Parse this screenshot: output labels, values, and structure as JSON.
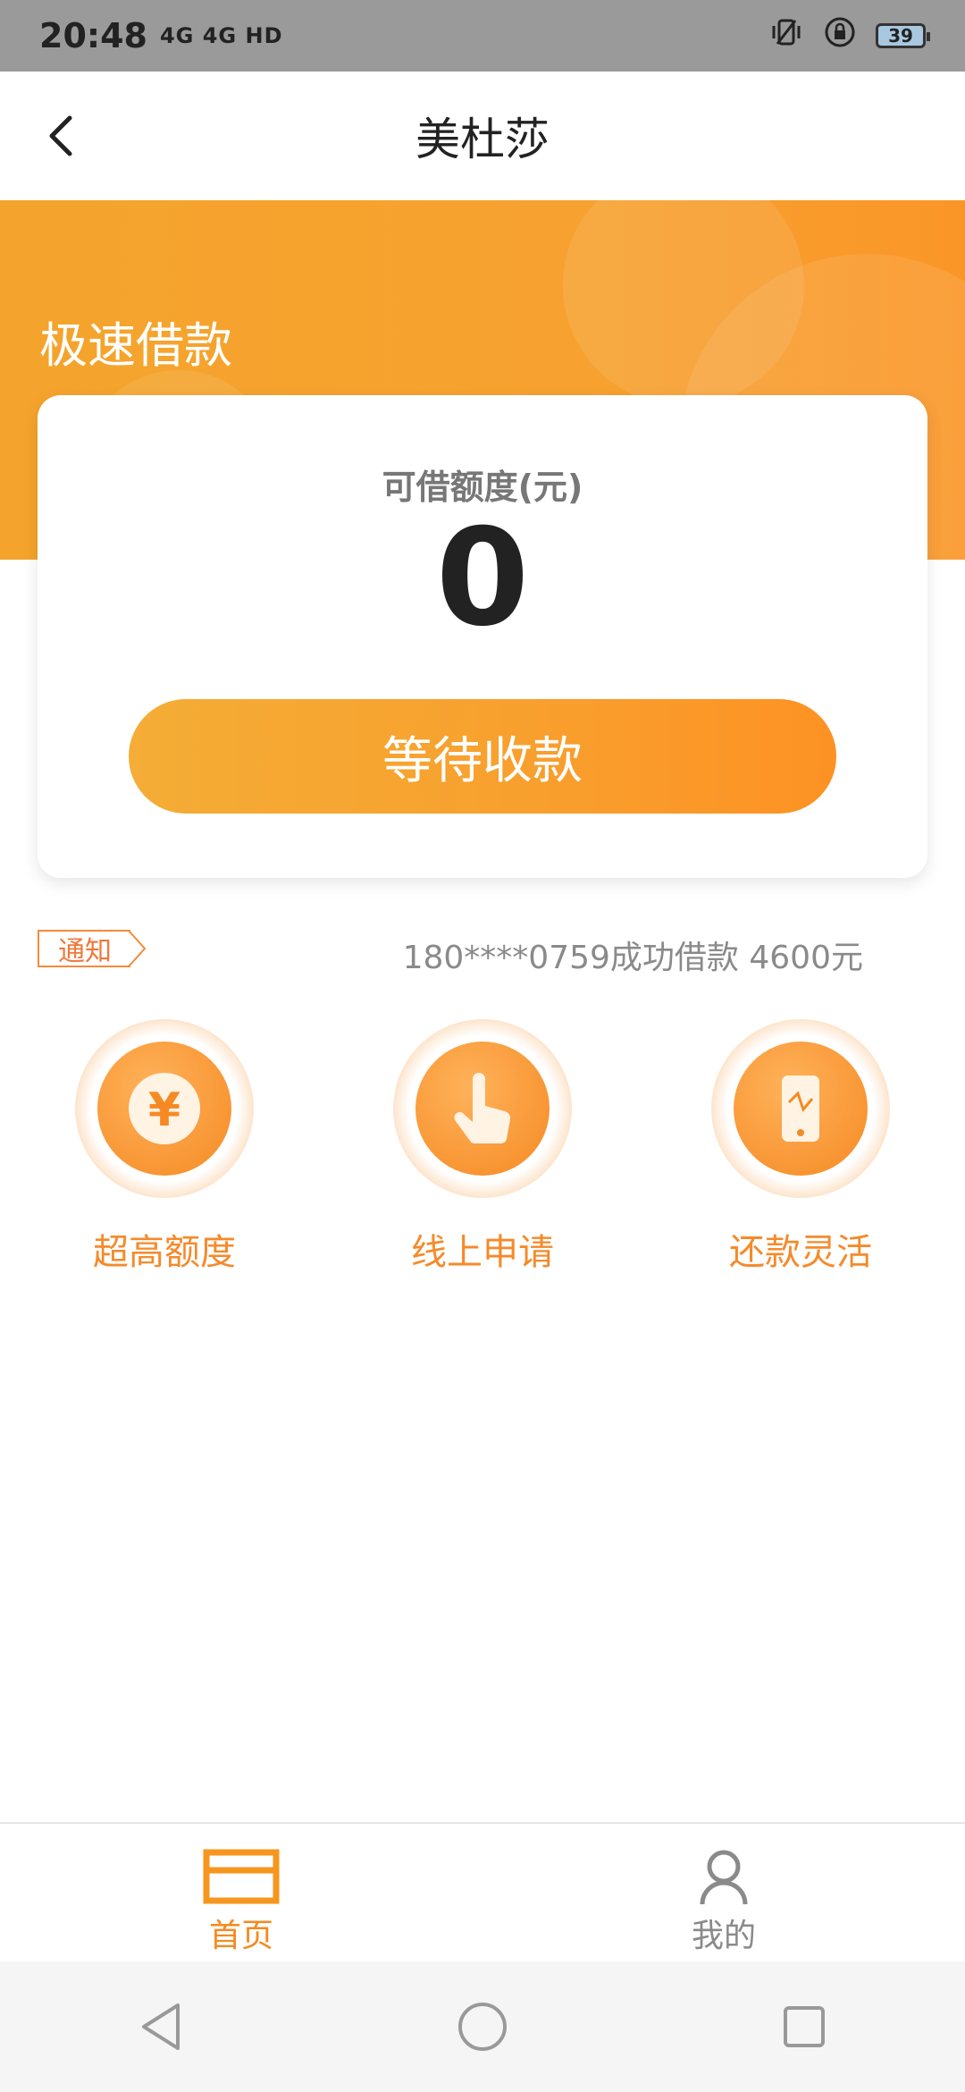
{
  "status_bar": {
    "time": "20:48",
    "network": "4G 4G HD",
    "battery": "39"
  },
  "header": {
    "title": "美杜莎",
    "back_icon": "chevron-left-icon"
  },
  "banner": {
    "title": "极速借款"
  },
  "card": {
    "label": "可借额度(元)",
    "amount": "0",
    "button_label": "等待收款"
  },
  "notice": {
    "tag": "通知",
    "text": "180****0759成功借款 4600元"
  },
  "features": [
    {
      "label": "超高额度",
      "icon": "yuan-coin-icon"
    },
    {
      "label": "线上申请",
      "icon": "hand-pointer-icon"
    },
    {
      "label": "还款灵活",
      "icon": "phone-icon"
    }
  ],
  "bottom_nav": [
    {
      "label": "首页",
      "icon": "home-card-icon",
      "active": true
    },
    {
      "label": "我的",
      "icon": "user-icon",
      "active": false
    }
  ],
  "colors": {
    "accent": "#f7a230",
    "accent_text": "#f58a2a",
    "inactive": "#8a8a8a"
  }
}
